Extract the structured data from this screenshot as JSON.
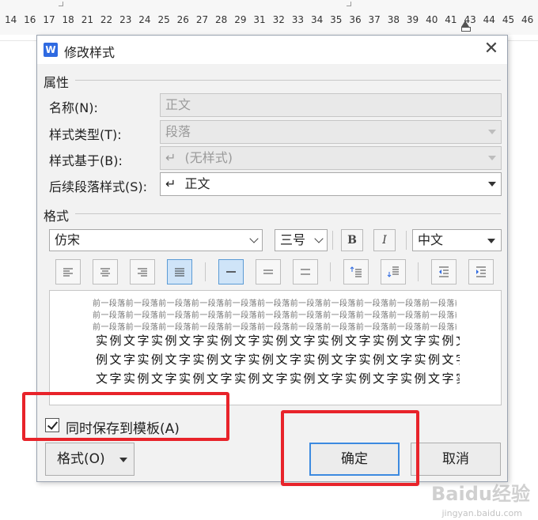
{
  "ruler": {
    "numbers": [
      "14",
      "16",
      "17",
      "18",
      "21",
      "22",
      "23",
      "24",
      "25",
      "26",
      "27",
      "28",
      "29",
      "31",
      "32",
      "33",
      "34",
      "35",
      "36",
      "37",
      "38",
      "39",
      "40",
      "41",
      "43",
      "44",
      "45",
      "46"
    ]
  },
  "dialog": {
    "app_logo": "W",
    "title": "修改样式",
    "close_glyph": "✕",
    "properties": {
      "section_label": "属性",
      "name_label": "名称(N):",
      "name_value": "正文",
      "style_type_label": "样式类型(T):",
      "style_type_value": "段落",
      "based_on_label": "样式基于(B):",
      "based_on_value": "(无样式)",
      "next_style_label": "后续段落样式(S):",
      "next_style_value": "正文",
      "return_glyph": "↵"
    },
    "format": {
      "section_label": "格式",
      "font_value": "仿宋",
      "size_value": "三号",
      "bold_label": "B",
      "italic_label": "I",
      "script_value": "中文",
      "paragraph_buttons": [
        {
          "name": "align-left-button",
          "icon": "align-left-icon",
          "active": false
        },
        {
          "name": "align-center-button",
          "icon": "align-center-icon",
          "active": false
        },
        {
          "name": "align-right-button",
          "icon": "align-right-icon",
          "active": false
        },
        {
          "name": "align-justify-button",
          "icon": "align-justify-icon",
          "active": true
        },
        {
          "name": "line-spacing-single-button",
          "icon": "line-single-icon",
          "active": true
        },
        {
          "name": "line-spacing-1-5-button",
          "icon": "line-onehalf-icon",
          "active": false
        },
        {
          "name": "line-spacing-double-button",
          "icon": "line-double-icon",
          "active": false
        },
        {
          "name": "space-before-button",
          "icon": "space-before-icon",
          "active": false
        },
        {
          "name": "space-after-button",
          "icon": "space-after-icon",
          "active": false
        },
        {
          "name": "decrease-indent-button",
          "icon": "indent-decrease-icon",
          "active": false
        },
        {
          "name": "increase-indent-button",
          "icon": "indent-increase-icon",
          "active": false
        }
      ]
    },
    "preview": {
      "prev_lines": [
        "前一段落前一段落前一段落前一段落前一段落前一段落前一段落前一段落前一段落前一段落前一段落前一段落",
        "前一段落前一段落前一段落前一段落前一段落前一段落前一段落前一段落前一段落前一段落前一段落前一段落",
        "前一段落前一段落前一段落前一段落前一段落前一段落前一段落前一段落前一段落前一段落前一段落前一段落"
      ],
      "sample_lines": [
        "实例文字实例文字实例文字实例文字实例文字实例文字实例文字实",
        "例文字实例文字实例文字实例文字实例文字实例文字实例文字实例",
        "文字实例文字实例文字实例文字实例文字实例文字实例文字实例文"
      ]
    },
    "add_to_template_label": "同时保存到模板(A)",
    "add_to_template_checked": true,
    "format_button_label": "格式(O)",
    "ok_button_label": "确定",
    "cancel_button_label": "取消"
  },
  "watermark": {
    "text": "Baidu经验",
    "sub": "jingyan.baidu.com"
  },
  "colors": {
    "accent": "#3c8ae0",
    "highlight": "#e8232a",
    "active_bg": "#cfe4f8"
  }
}
